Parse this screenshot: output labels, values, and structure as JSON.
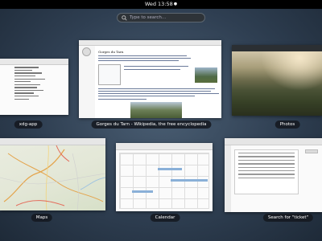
{
  "topbar": {
    "clock": "Wed 13:58",
    "clock_indicator": "●"
  },
  "search": {
    "placeholder": "Type to search..."
  },
  "windows": [
    {
      "caption": "xdg-app"
    },
    {
      "caption": "Gorges du Tarn - Wikipedia, the free encyclopedia",
      "page_title": "Gorges du Tarn"
    },
    {
      "caption": "Photos"
    },
    {
      "caption": "Maps"
    },
    {
      "caption": "Calendar"
    },
    {
      "caption": "Search for \"ticket\""
    }
  ],
  "colors": {
    "topbar": "#000000",
    "background": "#3a4c5f",
    "caption_bg": "#14181e"
  }
}
